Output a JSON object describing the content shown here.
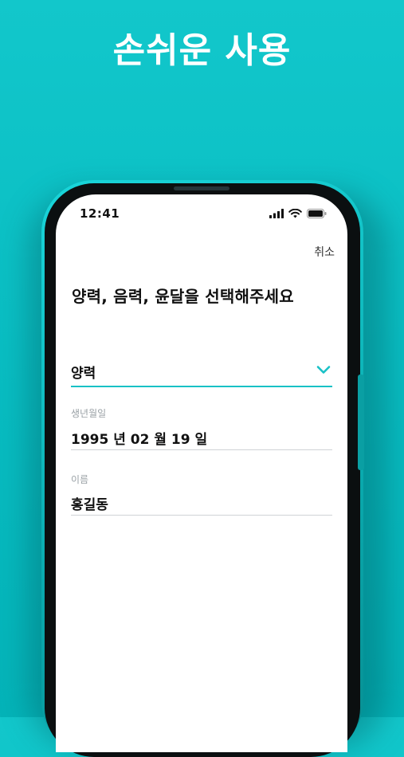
{
  "headline": "손쉬운 사용",
  "status_bar": {
    "time": "12:41",
    "signal_icon": "cellular-signal-icon",
    "wifi_icon": "wifi-icon",
    "battery_icon": "battery-icon"
  },
  "header": {
    "cancel_label": "취소"
  },
  "form": {
    "title": "양력, 음력, 윤달을 선택해주세요",
    "calendar_type": {
      "value": "양력",
      "icon": "chevron-down-icon"
    },
    "birthdate": {
      "label": "생년월일",
      "value": "1995 년 02 월 19 일"
    },
    "name": {
      "label": "이름",
      "value": "홍길동"
    }
  },
  "colors": {
    "background": "#0dc3c7",
    "accent": "#18c1c6",
    "text": "#111111",
    "label": "#9aa1a6",
    "divider": "#cfd3d6"
  }
}
